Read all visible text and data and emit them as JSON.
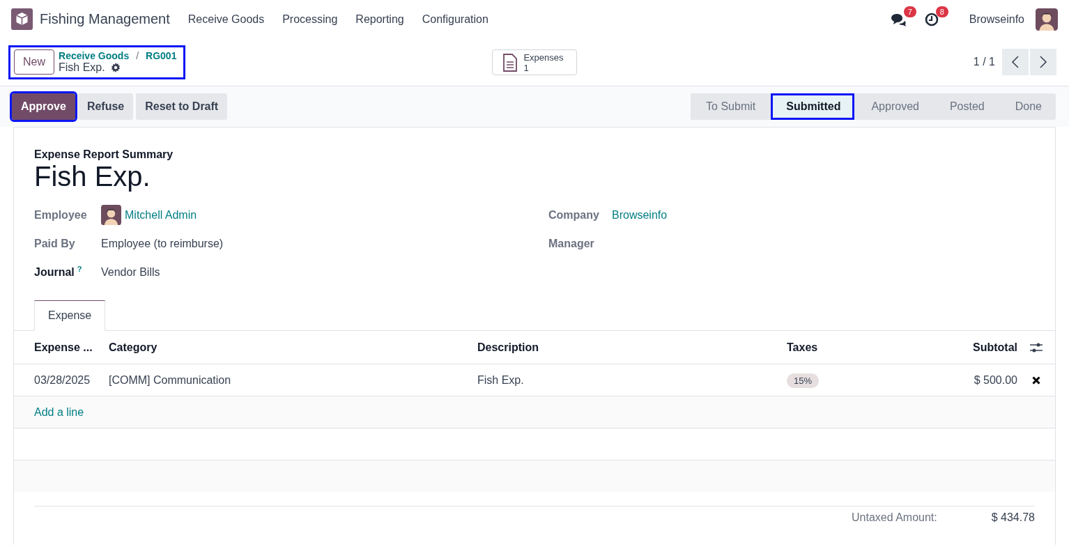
{
  "navbar": {
    "app_name": "Fishing Management",
    "menus": [
      "Receive Goods",
      "Processing",
      "Reporting",
      "Configuration"
    ],
    "messages_badge": "7",
    "activities_badge": "8",
    "user_name": "Browseinfo"
  },
  "control_panel": {
    "new_button": "New",
    "breadcrumb_highlighted": true,
    "breadcrumbs": [
      "Receive Goods",
      "RG001"
    ],
    "breadcrumb_separator": "/",
    "record_title": "Fish Exp.",
    "smart_button": {
      "label": "Expenses",
      "count": "1"
    },
    "pager": "1 / 1"
  },
  "actions": [
    {
      "label": "Approve",
      "primary": true,
      "highlighted": true
    },
    {
      "label": "Refuse",
      "primary": false,
      "highlighted": false
    },
    {
      "label": "Reset to Draft",
      "primary": false,
      "highlighted": false
    }
  ],
  "stages": [
    {
      "label": "To Submit",
      "selected": false,
      "highlighted": false
    },
    {
      "label": "Submitted",
      "selected": true,
      "highlighted": true
    },
    {
      "label": "Approved",
      "selected": false,
      "highlighted": false
    },
    {
      "label": "Posted",
      "selected": false,
      "highlighted": false
    },
    {
      "label": "Done",
      "selected": false,
      "highlighted": false
    }
  ],
  "sheet": {
    "subtitle": "Expense Report Summary",
    "title": "Fish Exp.",
    "left_fields": [
      {
        "label": "Employee",
        "value": "Mitchell Admin",
        "kind": "avatar-link"
      },
      {
        "label": "Paid By",
        "value": "Employee (to reimburse)",
        "kind": "text"
      },
      {
        "label": "Journal",
        "value": "Vendor Bills",
        "kind": "text",
        "required": true,
        "help": "?"
      }
    ],
    "right_fields": [
      {
        "label": "Company",
        "value": "Browseinfo",
        "kind": "link"
      },
      {
        "label": "Manager"
      }
    ],
    "tabs": [
      {
        "label": "Expense",
        "selected": true
      }
    ],
    "table": {
      "columns": [
        "Expense ...",
        "Category",
        "Description",
        "Taxes",
        "Subtotal"
      ],
      "rows": [
        {
          "date": "03/28/2025",
          "category": "[COMM] Communication",
          "description": "Fish Exp.",
          "tax": "15%",
          "subtotal": "$ 500.00"
        }
      ],
      "add_line": "Add a line"
    },
    "totals": [
      {
        "label": "Untaxed Amount:",
        "value": "$ 434.78"
      }
    ]
  }
}
